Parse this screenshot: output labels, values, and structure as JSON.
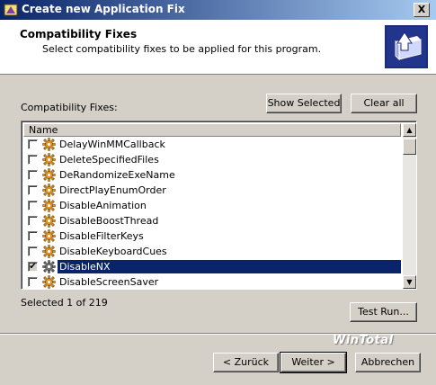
{
  "window": {
    "title": "Create new Application Fix",
    "close_glyph": "X"
  },
  "header": {
    "title": "Compatibility Fixes",
    "subtitle": "Select compatibility fixes to be applied for this program.",
    "icon": "application-box-icon"
  },
  "fixes_section": {
    "label": "Compatibility Fixes:",
    "show_selected_label": "Show Selected",
    "clear_all_label": "Clear all"
  },
  "list": {
    "column_header": "Name",
    "items": [
      {
        "name": "DelayWinMMCallback",
        "checked": false,
        "selected": false
      },
      {
        "name": "DeleteSpecifiedFiles",
        "checked": false,
        "selected": false
      },
      {
        "name": "DeRandomizeExeName",
        "checked": false,
        "selected": false
      },
      {
        "name": "DirectPlayEnumOrder",
        "checked": false,
        "selected": false
      },
      {
        "name": "DisableAnimation",
        "checked": false,
        "selected": false
      },
      {
        "name": "DisableBoostThread",
        "checked": false,
        "selected": false
      },
      {
        "name": "DisableFilterKeys",
        "checked": false,
        "selected": false
      },
      {
        "name": "DisableKeyboardCues",
        "checked": false,
        "selected": false
      },
      {
        "name": "DisableNX",
        "checked": true,
        "selected": true
      },
      {
        "name": "DisableScreenSaver",
        "checked": false,
        "selected": false
      }
    ],
    "check_glyph": "✔",
    "scroll_up_glyph": "▲",
    "scroll_down_glyph": "▼"
  },
  "status": {
    "selected_text": "Selected 1 of 219"
  },
  "buttons": {
    "test_run": "Test Run...",
    "back": "< Zurück",
    "next": "Weiter >",
    "cancel": "Abbrechen"
  },
  "watermark": "WinTotal",
  "colors": {
    "selection": "#0a246a",
    "titlebar_start": "#0a246a",
    "titlebar_end": "#a6caf0",
    "face": "#d4d0c8"
  }
}
